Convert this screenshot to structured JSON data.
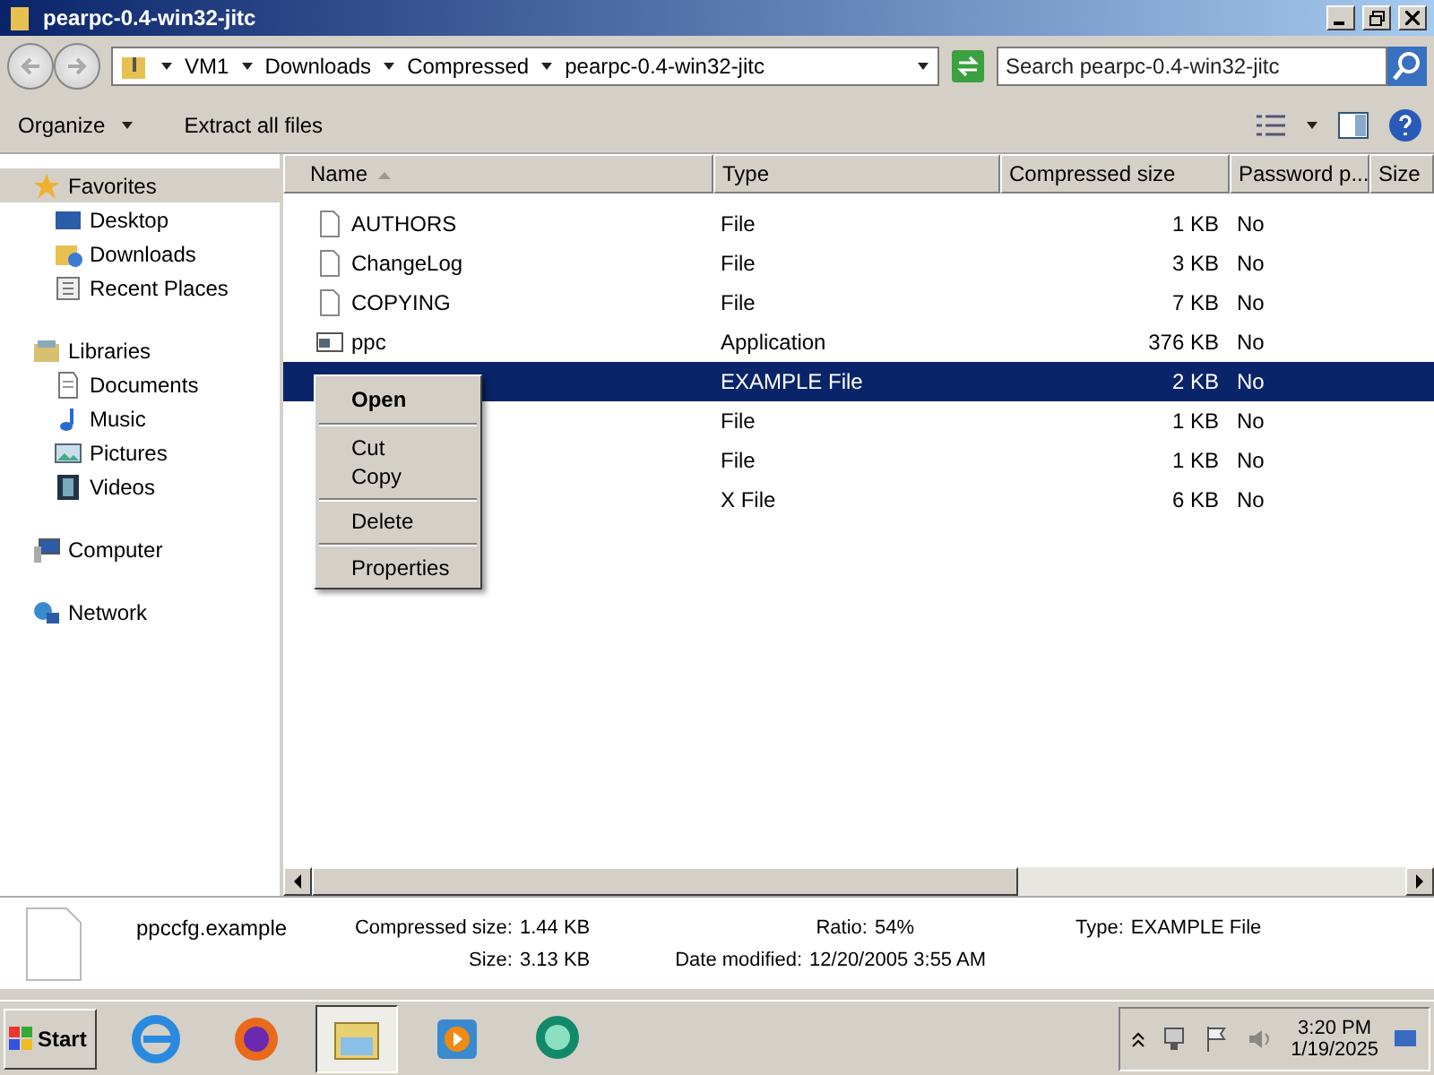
{
  "window": {
    "title": "pearpc-0.4-win32-jitc"
  },
  "address": {
    "crumbs": [
      "VM1",
      "Downloads",
      "Compressed",
      "pearpc-0.4-win32-jitc"
    ],
    "search_placeholder": "Search pearpc-0.4-win32-jitc"
  },
  "toolbar": {
    "buttons": [
      {
        "label": "Organize",
        "kind": "menu"
      },
      {
        "label": "Extract all files",
        "kind": "plain"
      }
    ]
  },
  "sidebar": {
    "groups": [
      {
        "label": "Favorites",
        "kind": "star",
        "selected": true,
        "children": [
          {
            "label": "Desktop",
            "kind": "desktop"
          },
          {
            "label": "Downloads",
            "kind": "downloads"
          },
          {
            "label": "Recent Places",
            "kind": "recent"
          }
        ]
      },
      {
        "label": "Libraries",
        "kind": "libraries",
        "selected": false,
        "children": [
          {
            "label": "Documents",
            "kind": "documents"
          },
          {
            "label": "Music",
            "kind": "music"
          },
          {
            "label": "Pictures",
            "kind": "pictures"
          },
          {
            "label": "Videos",
            "kind": "videos"
          }
        ]
      },
      {
        "label": "Computer",
        "kind": "computer",
        "selected": false
      },
      {
        "label": "Network",
        "kind": "network",
        "selected": false
      }
    ]
  },
  "table": {
    "columns": [
      "Name",
      "Type",
      "Compressed size",
      "Password p...",
      "Size"
    ],
    "rows": [
      {
        "name": "AUTHORS",
        "kind": "file",
        "type": "File",
        "compressed": "1 KB",
        "password": "No",
        "selected": false
      },
      {
        "name": "ChangeLog",
        "kind": "file",
        "type": "File",
        "compressed": "3 KB",
        "password": "No",
        "selected": false
      },
      {
        "name": "COPYING",
        "kind": "file",
        "type": "File",
        "compressed": "7 KB",
        "password": "No",
        "selected": false
      },
      {
        "name": "ppc",
        "kind": "app",
        "type": "Application",
        "compressed": "376 KB",
        "password": "No",
        "selected": false
      },
      {
        "type": "EXAMPLE File",
        "compressed": "2 KB",
        "password": "No",
        "selected": true
      },
      {
        "type": "File",
        "compressed": "1 KB",
        "password": "No",
        "selected": false
      },
      {
        "type": "File",
        "compressed": "1 KB",
        "password": "No",
        "selected": false
      },
      {
        "type": "X File",
        "compressed": "6 KB",
        "password": "No",
        "selected": false
      }
    ]
  },
  "context_menu": {
    "items": [
      {
        "label": "Open",
        "bold": true,
        "separator_after": true
      },
      {
        "label": "Cut",
        "bold": false,
        "separator_after": false
      },
      {
        "label": "Copy",
        "bold": false,
        "separator_after": true
      },
      {
        "label": "Delete",
        "bold": false,
        "separator_after": true
      },
      {
        "label": "Properties",
        "bold": false,
        "separator_after": false
      }
    ]
  },
  "details": {
    "name": "ppccfg.example",
    "fields": [
      {
        "label": "Compressed size:",
        "value": "1.44 KB"
      },
      {
        "label": "Ratio:",
        "value": "54%"
      },
      {
        "label": "Type:",
        "value": "EXAMPLE File"
      },
      {
        "label": "Size:",
        "value": "3.13 KB"
      },
      {
        "label": "Date modified:",
        "value": "12/20/2005 3:55 AM"
      }
    ]
  },
  "taskbar": {
    "start": "Start",
    "apps": [
      {
        "kind": "ie",
        "selected": false
      },
      {
        "kind": "firefox",
        "selected": false
      },
      {
        "kind": "explorer",
        "selected": true
      },
      {
        "kind": "media",
        "selected": false
      },
      {
        "kind": "chat",
        "selected": false
      }
    ],
    "time": "3:20 PM",
    "date": "1/19/2025"
  }
}
